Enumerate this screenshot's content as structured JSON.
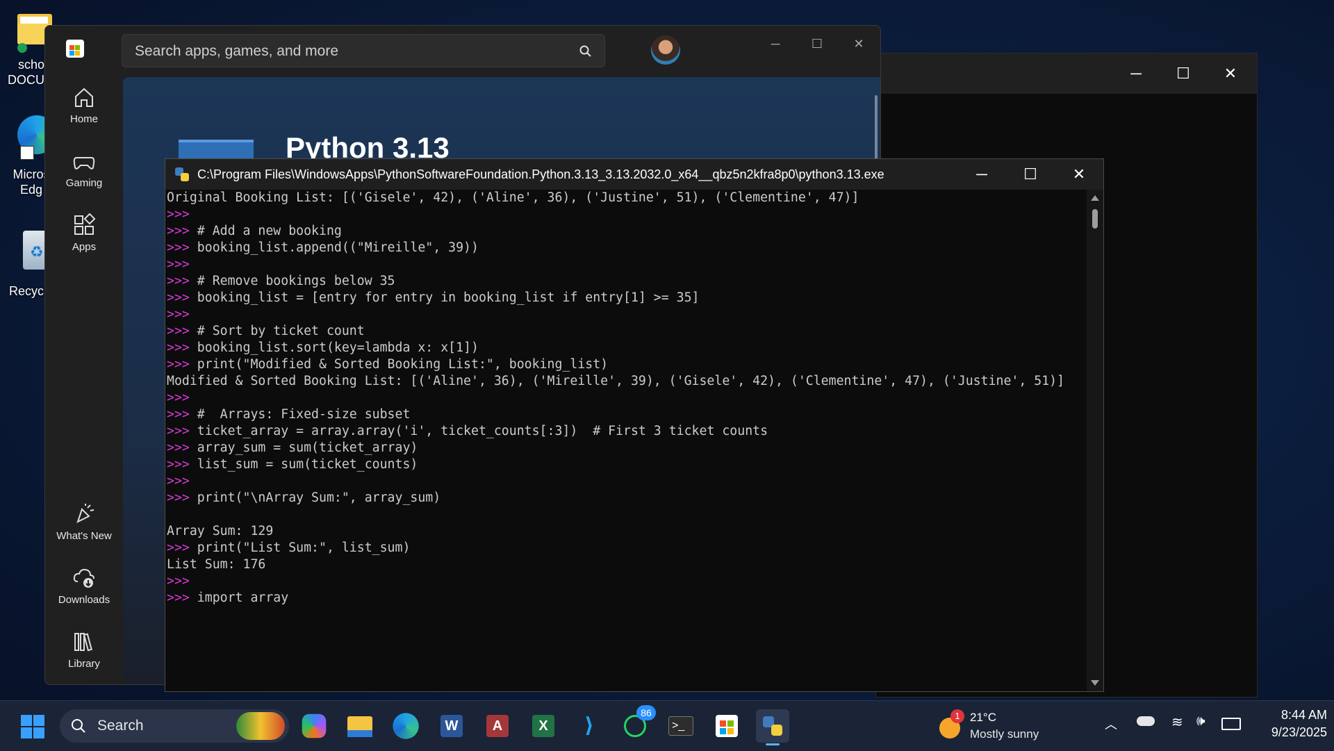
{
  "desktop": {
    "icons": [
      {
        "label": "scho\nDOCUM",
        "icon": "folder-icon"
      },
      {
        "label": "Micros\nEdg",
        "icon": "edge-icon"
      },
      {
        "label": "Recycle",
        "icon": "recycle-bin-icon"
      }
    ]
  },
  "store": {
    "search_placeholder": "Search apps, games, and more",
    "nav": [
      {
        "label": "Home",
        "icon": "home-icon"
      },
      {
        "label": "Gaming",
        "icon": "gamepad-icon"
      },
      {
        "label": "Apps",
        "icon": "apps-icon"
      },
      {
        "label": "What's New",
        "icon": "whats-new-icon"
      },
      {
        "label": "Downloads",
        "icon": "downloads-icon"
      },
      {
        "label": "Library",
        "icon": "library-icon"
      }
    ],
    "app_title": "Python 3.13"
  },
  "python_window": {
    "title": "C:\\Program Files\\WindowsApps\\PythonSoftwareFoundation.Python.3.13_3.13.2032.0_x64__qbz5n2kfra8p0\\python3.13.exe",
    "lines": [
      {
        "prompt": "",
        "text": "Original Booking List: [('Gisele', 42), ('Aline', 36), ('Justine', 51), ('Clementine', 47)]"
      },
      {
        "prompt": ">>>",
        "text": ""
      },
      {
        "prompt": ">>>",
        "text": " # Add a new booking"
      },
      {
        "prompt": ">>>",
        "text": " booking_list.append((\"Mireille\", 39))"
      },
      {
        "prompt": ">>>",
        "text": ""
      },
      {
        "prompt": ">>>",
        "text": " # Remove bookings below 35"
      },
      {
        "prompt": ">>>",
        "text": " booking_list = [entry for entry in booking_list if entry[1] >= 35]"
      },
      {
        "prompt": ">>>",
        "text": ""
      },
      {
        "prompt": ">>>",
        "text": " # Sort by ticket count"
      },
      {
        "prompt": ">>>",
        "text": " booking_list.sort(key=lambda x: x[1])"
      },
      {
        "prompt": ">>>",
        "text": " print(\"Modified & Sorted Booking List:\", booking_list)"
      },
      {
        "prompt": "",
        "text": "Modified & Sorted Booking List: [('Aline', 36), ('Mireille', 39), ('Gisele', 42), ('Clementine', 47), ('Justine', 51)]"
      },
      {
        "prompt": ">>>",
        "text": ""
      },
      {
        "prompt": ">>>",
        "text": " #  Arrays: Fixed-size subset"
      },
      {
        "prompt": ">>>",
        "text": " ticket_array = array.array('i', ticket_counts[:3])  # First 3 ticket counts"
      },
      {
        "prompt": ">>>",
        "text": " array_sum = sum(ticket_array)"
      },
      {
        "prompt": ">>>",
        "text": " list_sum = sum(ticket_counts)"
      },
      {
        "prompt": ">>>",
        "text": ""
      },
      {
        "prompt": ">>>",
        "text": " print(\"\\nArray Sum:\", array_sum)"
      },
      {
        "prompt": "",
        "text": ""
      },
      {
        "prompt": "",
        "text": "Array Sum: 129"
      },
      {
        "prompt": ">>>",
        "text": " print(\"List Sum:\", list_sum)"
      },
      {
        "prompt": "",
        "text": "List Sum: 176"
      },
      {
        "prompt": ">>>",
        "text": ""
      },
      {
        "prompt": ">>>",
        "text": " import array"
      }
    ]
  },
  "taskbar": {
    "search_label": "Search",
    "whatsapp_badge": "86",
    "weather_badge": "1",
    "weather_temp": "21°C",
    "weather_desc": "Mostly sunny",
    "time": "8:44 AM",
    "date": "9/23/2025",
    "apps": [
      "copilot-icon",
      "file-explorer-icon",
      "edge-icon",
      "word-icon",
      "access-icon",
      "excel-icon",
      "vscode-icon",
      "whatsapp-icon",
      "terminal-icon",
      "store-icon",
      "python-icon"
    ]
  },
  "colors": {
    "prompt": "#d23bd2",
    "console_bg": "#0c0c0c",
    "taskbar_bg": "#1a2436"
  }
}
